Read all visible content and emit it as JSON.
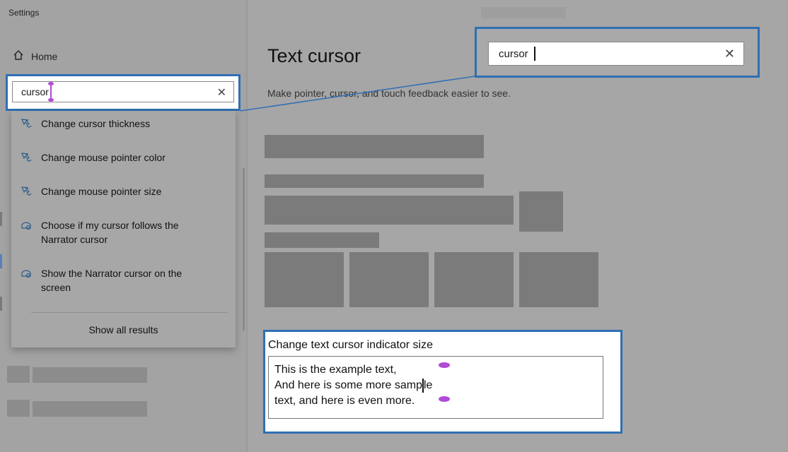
{
  "app": {
    "title": "Settings"
  },
  "sidebar": {
    "home_label": "Home"
  },
  "search": {
    "value": "cursor",
    "results": [
      {
        "label": "Change cursor thickness",
        "icon": "pointer-hand-icon"
      },
      {
        "label": "Change mouse pointer color",
        "icon": "pointer-hand-icon"
      },
      {
        "label": "Change mouse pointer size",
        "icon": "pointer-hand-icon"
      },
      {
        "label": "Choose if my cursor follows the Narrator cursor",
        "icon": "narrator-icon"
      },
      {
        "label": "Show the Narrator cursor on the screen",
        "icon": "narrator-icon"
      }
    ],
    "show_all_label": "Show all results"
  },
  "main": {
    "title": "Text cursor",
    "description": "Make pointer, cursor, and touch feedback easier to see."
  },
  "example": {
    "title": "Change text cursor indicator size",
    "lines": [
      "This is the example text,",
      "And here is some more sample",
      "text, and here is even more."
    ],
    "line2_before_caret": "And here is some more samp",
    "line2_after_caret": "le"
  },
  "colors": {
    "highlight_border": "#2f6fb4",
    "indicator_purple": "#b14ad6",
    "placeholder_gray": "#7b7b7b"
  }
}
